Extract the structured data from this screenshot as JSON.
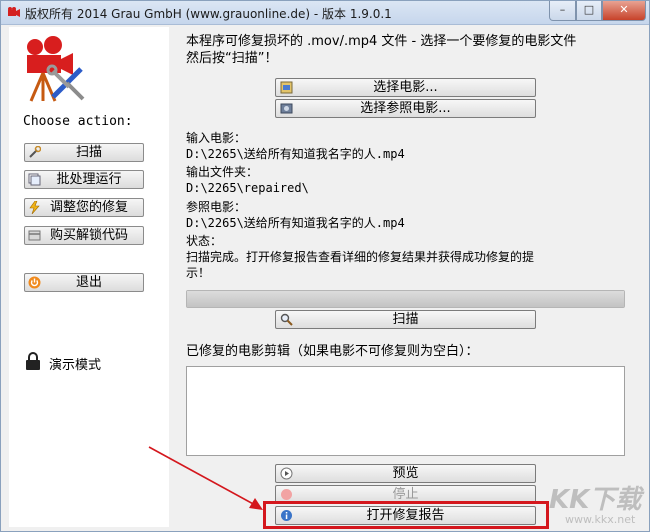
{
  "window": {
    "title": "版权所有 2014 Grau GmbH (www.grauonline.de) - 版本 1.9.0.1",
    "controls": {
      "minimize": "–",
      "maximize": "□",
      "close": "✕"
    }
  },
  "sidebar": {
    "choose_label": "Choose action:",
    "buttons": [
      {
        "label": "扫描",
        "icon": "wrench-icon"
      },
      {
        "label": "批处理运行",
        "icon": "batch-icon"
      },
      {
        "label": "调整您的修复",
        "icon": "lightning-icon"
      },
      {
        "label": "购买解锁代码",
        "icon": "card-icon"
      },
      {
        "label": "退出",
        "icon": "power-icon"
      }
    ],
    "demo_label": "演示模式"
  },
  "main": {
    "intro_line1": "本程序可修复损坏的 .mov/.mp4 文件 - 选择一个要修复的电影文件",
    "intro_line2": "然后按“扫描”！",
    "select_movie_button": "选择电影...",
    "select_reference_button": "选择参照电影...",
    "input_label": "输入电影：",
    "input_value": "D:\\2265\\送给所有知道我名字的人.mp4",
    "output_label": "输出文件夹：",
    "output_value": "D:\\2265\\repaired\\",
    "reference_label": "参照电影：",
    "reference_value": "D:\\2265\\送给所有知道我名字的人.mp4",
    "status_label": "状态：",
    "status_line1": "扫描完成。打开修复报告查看详细的修复结果并获得成功修复的提",
    "status_line2": "示！",
    "progress": 1.0,
    "scan_button": "扫描",
    "repaired_list_label": "已修复的电影剪辑（如果电影不可修复则为空白）：",
    "preview_button": "预览",
    "stop_button": "停止",
    "open_report_button": "打开修复报告"
  },
  "watermark": {
    "big": "KK下载",
    "small": "www.kkx.net"
  },
  "colors": {
    "highlight": "#d4171d",
    "window_bg": "#f0f0f0",
    "titlebar": "#c6d6ec"
  }
}
